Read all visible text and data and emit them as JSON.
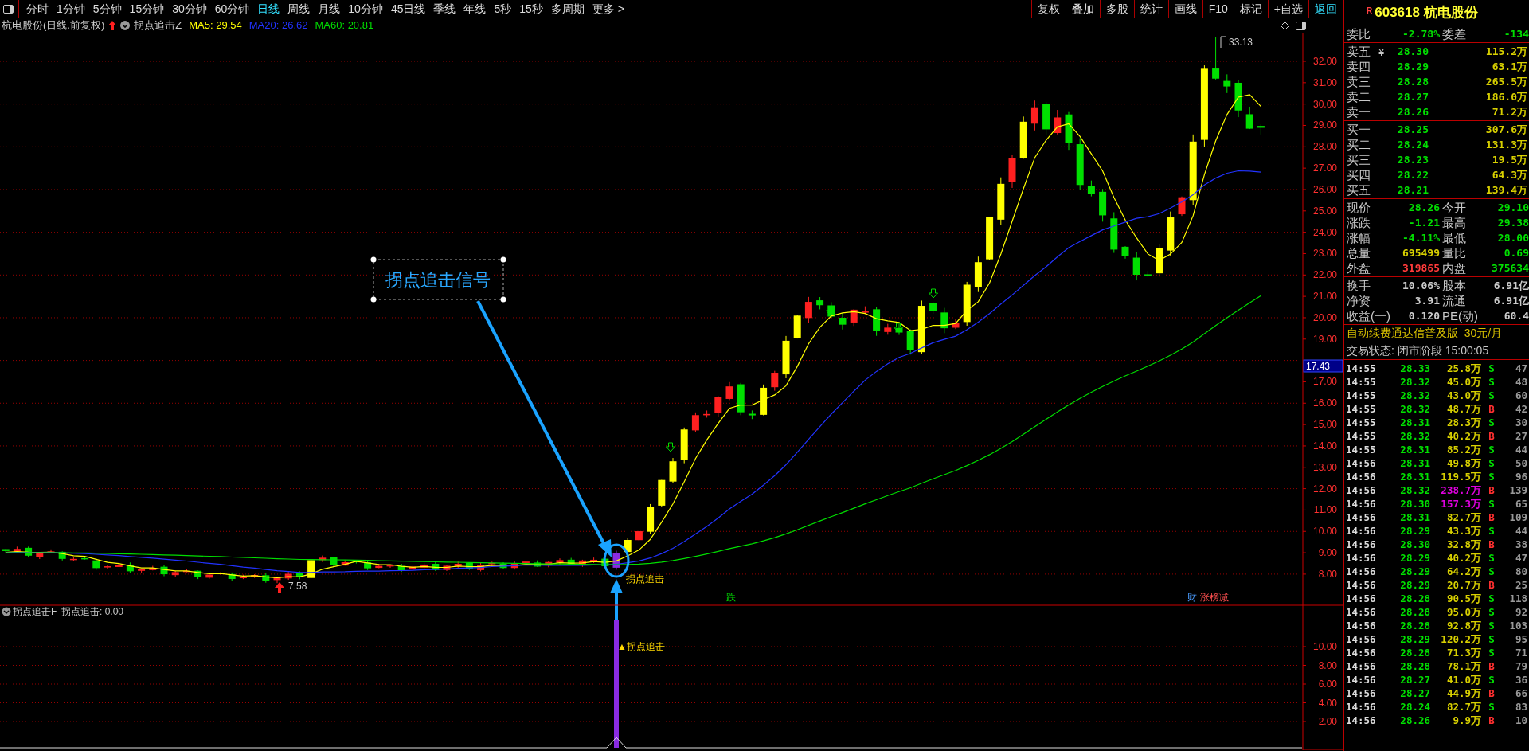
{
  "toolbar": {
    "periods": [
      {
        "label": "分时",
        "selected": false
      },
      {
        "label": "1分钟",
        "selected": false
      },
      {
        "label": "5分钟",
        "selected": false
      },
      {
        "label": "15分钟",
        "selected": false
      },
      {
        "label": "30分钟",
        "selected": false
      },
      {
        "label": "60分钟",
        "selected": false
      },
      {
        "label": "日线",
        "selected": true
      },
      {
        "label": "周线",
        "selected": false
      },
      {
        "label": "月线",
        "selected": false
      },
      {
        "label": "10分钟",
        "selected": false
      },
      {
        "label": "45日线",
        "selected": false
      },
      {
        "label": "季线",
        "selected": false
      },
      {
        "label": "年线",
        "selected": false
      },
      {
        "label": "5秒",
        "selected": false
      },
      {
        "label": "15秒",
        "selected": false
      },
      {
        "label": "多周期",
        "selected": false
      }
    ],
    "more": "更多 >",
    "tools": [
      {
        "label": "复权",
        "accent": false
      },
      {
        "label": "叠加",
        "accent": false
      },
      {
        "label": "多股",
        "accent": false
      },
      {
        "label": "统计",
        "accent": false
      },
      {
        "label": "画线",
        "accent": false
      },
      {
        "label": "F10",
        "accent": false
      },
      {
        "label": "标记",
        "accent": false
      },
      {
        "label": "+自选",
        "accent": false
      },
      {
        "label": "返回",
        "accent": true
      }
    ]
  },
  "chart_header": {
    "title": "杭电股份(日线.前复权)",
    "indicator": "拐点追击Z",
    "averages": [
      {
        "label": "MA5: 29.54",
        "color": "#ffff00"
      },
      {
        "label": "MA20: 26.62",
        "color": "#2233ff"
      },
      {
        "label": "MA60: 20.81",
        "color": "#00dd00"
      }
    ]
  },
  "main_chart": {
    "yticks": [
      "32.00",
      "31.00",
      "30.00",
      "29.00",
      "28.00",
      "27.00",
      "26.00",
      "25.00",
      "24.00",
      "23.00",
      "22.00",
      "21.00",
      "20.00",
      "19.00",
      "17.00",
      "16.00",
      "15.00",
      "14.00",
      "13.00",
      "12.00",
      "11.00",
      "10.00",
      "9.00",
      "8.00"
    ],
    "price_tag": "17.43",
    "high_label": "33.13",
    "low_label": "7.58",
    "signal_label": "拐点追击",
    "callout": "拐点追击信号",
    "markers": [
      {
        "text": "跌",
        "kind": "fall"
      },
      {
        "text": "财",
        "kind": "finance"
      },
      {
        "text": "涨榜减",
        "kind": "rank"
      }
    ]
  },
  "indicator": {
    "name": "拐点追击F",
    "reading": "拐点追击: 0.00",
    "signal_label": "▲拐点追击",
    "yticks": [
      "10.00",
      "8.00",
      "6.00",
      "4.00",
      "2.00"
    ]
  },
  "quote": {
    "flag": "R",
    "title": "603618 杭电股份",
    "ratio": {
      "label": "委比",
      "value": "-2.78%",
      "label2": "委差",
      "value2": "-134"
    },
    "asks": [
      {
        "label": "卖五",
        "mark": "¥",
        "price": "28.30",
        "volume": "115.2万"
      },
      {
        "label": "卖四",
        "price": "28.29",
        "volume": "63.1万"
      },
      {
        "label": "卖三",
        "price": "28.28",
        "volume": "265.5万"
      },
      {
        "label": "卖二",
        "price": "28.27",
        "volume": "186.0万"
      },
      {
        "label": "卖一",
        "price": "28.26",
        "volume": "71.2万"
      }
    ],
    "bids": [
      {
        "label": "买一",
        "price": "28.25",
        "volume": "307.6万"
      },
      {
        "label": "买二",
        "price": "28.24",
        "volume": "131.3万"
      },
      {
        "label": "买三",
        "price": "28.23",
        "volume": "19.5万"
      },
      {
        "label": "买四",
        "price": "28.22",
        "volume": "64.3万"
      },
      {
        "label": "买五",
        "price": "28.21",
        "volume": "139.4万"
      }
    ],
    "stats": [
      {
        "label": "现价",
        "value": "28.26",
        "kind": "down",
        "label2": "今开",
        "value2": "29.10"
      },
      {
        "label": "涨跌",
        "value": "-1.21",
        "kind": "down",
        "label2": "最高",
        "value2": "29.38"
      },
      {
        "label": "涨幅",
        "value": "-4.11%",
        "kind": "down",
        "label2": "最低",
        "value2": "28.00"
      },
      {
        "label": "总量",
        "value": "695499",
        "kind": "volume",
        "label2": "量比",
        "value2": "0.69"
      },
      {
        "label": "外盘",
        "value": "319865",
        "kind": "up",
        "label2": "内盘",
        "value2": "375634"
      }
    ],
    "fundamentals": [
      {
        "label": "换手",
        "value": "10.06%",
        "label2": "股本",
        "value2": "6.91亿"
      },
      {
        "label": "净资",
        "value": "3.91",
        "label2": "流通",
        "value2": "6.91亿"
      },
      {
        "label": "收益(一)",
        "value": "0.120",
        "label2": "PE(动)",
        "value2": "60.4"
      }
    ],
    "promo": "自动续费通达信普及版  30元/月",
    "status": "交易状态: 闭市阶段 15:00:05",
    "ticks": [
      {
        "time": "14:55",
        "price": "28.33",
        "volume": "25.8万",
        "side": "S",
        "kind": "sell",
        "large": false,
        "count": "47"
      },
      {
        "time": "14:55",
        "price": "28.32",
        "volume": "45.0万",
        "side": "S",
        "kind": "sell",
        "large": false,
        "count": "48"
      },
      {
        "time": "14:55",
        "price": "28.32",
        "volume": "43.0万",
        "side": "S",
        "kind": "sell",
        "large": false,
        "count": "60"
      },
      {
        "time": "14:55",
        "price": "28.32",
        "volume": "48.7万",
        "side": "B",
        "kind": "buy",
        "large": false,
        "count": "42"
      },
      {
        "time": "14:55",
        "price": "28.31",
        "volume": "28.3万",
        "side": "S",
        "kind": "sell",
        "large": false,
        "count": "30"
      },
      {
        "time": "14:55",
        "price": "28.32",
        "volume": "40.2万",
        "side": "B",
        "kind": "buy",
        "large": false,
        "count": "27"
      },
      {
        "time": "14:55",
        "price": "28.31",
        "volume": "85.2万",
        "side": "S",
        "kind": "sell",
        "large": false,
        "count": "44"
      },
      {
        "time": "14:56",
        "price": "28.31",
        "volume": "49.8万",
        "side": "S",
        "kind": "sell",
        "large": false,
        "count": "50"
      },
      {
        "time": "14:56",
        "price": "28.31",
        "volume": "119.5万",
        "side": "S",
        "kind": "sell",
        "large": false,
        "count": "96"
      },
      {
        "time": "14:56",
        "price": "28.32",
        "volume": "238.7万",
        "side": "B",
        "kind": "buy",
        "large": true,
        "count": "139"
      },
      {
        "time": "14:56",
        "price": "28.30",
        "volume": "157.3万",
        "side": "S",
        "kind": "sell",
        "large": true,
        "count": "65"
      },
      {
        "time": "14:56",
        "price": "28.31",
        "volume": "82.7万",
        "side": "B",
        "kind": "buy",
        "large": false,
        "count": "109"
      },
      {
        "time": "14:56",
        "price": "28.29",
        "volume": "43.3万",
        "side": "S",
        "kind": "sell",
        "large": false,
        "count": "44"
      },
      {
        "time": "14:56",
        "price": "28.30",
        "volume": "32.8万",
        "side": "B",
        "kind": "buy",
        "large": false,
        "count": "38"
      },
      {
        "time": "14:56",
        "price": "28.29",
        "volume": "40.2万",
        "side": "S",
        "kind": "sell",
        "large": false,
        "count": "47"
      },
      {
        "time": "14:56",
        "price": "28.29",
        "volume": "64.2万",
        "side": "S",
        "kind": "sell",
        "large": false,
        "count": "80"
      },
      {
        "time": "14:56",
        "price": "28.29",
        "volume": "20.7万",
        "side": "B",
        "kind": "buy",
        "large": false,
        "count": "25"
      },
      {
        "time": "14:56",
        "price": "28.28",
        "volume": "90.5万",
        "side": "S",
        "kind": "sell",
        "large": false,
        "count": "118"
      },
      {
        "time": "14:56",
        "price": "28.28",
        "volume": "95.0万",
        "side": "S",
        "kind": "sell",
        "large": false,
        "count": "92"
      },
      {
        "time": "14:56",
        "price": "28.28",
        "volume": "92.8万",
        "side": "S",
        "kind": "sell",
        "large": false,
        "count": "103"
      },
      {
        "time": "14:56",
        "price": "28.29",
        "volume": "120.2万",
        "side": "S",
        "kind": "sell",
        "large": false,
        "count": "95"
      },
      {
        "time": "14:56",
        "price": "28.28",
        "volume": "71.3万",
        "side": "S",
        "kind": "sell",
        "large": false,
        "count": "71"
      },
      {
        "time": "14:56",
        "price": "28.28",
        "volume": "78.1万",
        "side": "B",
        "kind": "buy",
        "large": false,
        "count": "79"
      },
      {
        "time": "14:56",
        "price": "28.27",
        "volume": "41.0万",
        "side": "S",
        "kind": "sell",
        "large": false,
        "count": "36"
      },
      {
        "time": "14:56",
        "price": "28.27",
        "volume": "44.9万",
        "side": "B",
        "kind": "buy",
        "large": false,
        "count": "66"
      },
      {
        "time": "14:56",
        "price": "28.24",
        "volume": "82.7万",
        "side": "S",
        "kind": "sell",
        "large": false,
        "count": "83"
      },
      {
        "time": "14:56",
        "price": "28.26",
        "volume": "9.9万",
        "side": "B",
        "kind": "buy",
        "large": false,
        "count": "10"
      }
    ]
  }
}
